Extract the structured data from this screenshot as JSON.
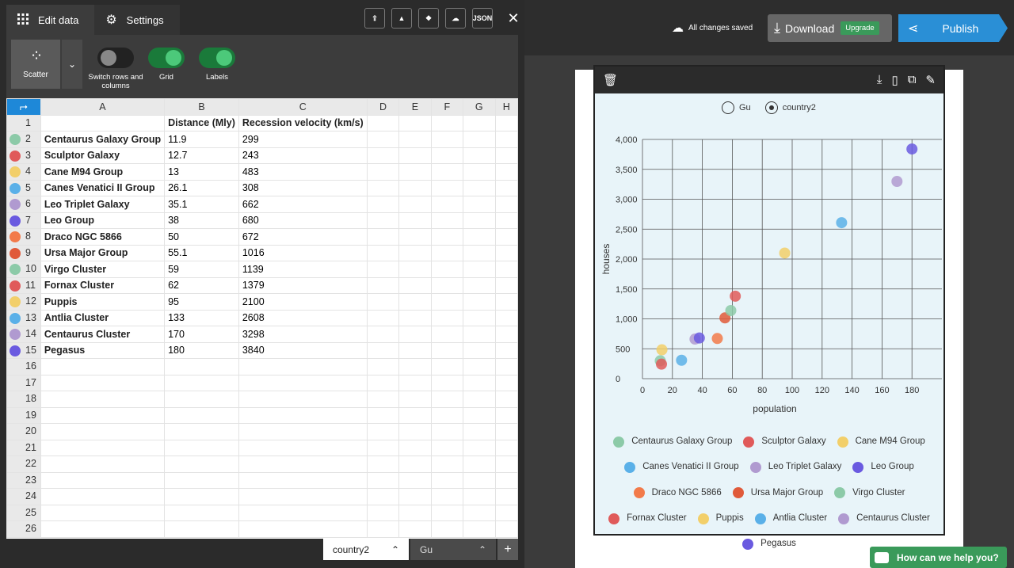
{
  "tabs": {
    "edit": "Edit data",
    "settings": "Settings"
  },
  "top_icons": {
    "json_label": "JSON",
    "close": "✕"
  },
  "toolbar": {
    "chart_type": "Scatter",
    "switch_label": "Switch rows and columns",
    "grid_label": "Grid",
    "labels_label": "Labels",
    "switch_on": false,
    "grid_on": true,
    "labels_on": true
  },
  "sheet": {
    "columns": [
      "A",
      "B",
      "C",
      "D",
      "E",
      "F",
      "G",
      "H"
    ],
    "header_row": [
      "",
      "Distance (Mly)",
      "Recession velocity (km/s)"
    ],
    "rows": [
      {
        "n": "2",
        "name": "Centaurus Galaxy Group",
        "b": "11.9",
        "c": "299",
        "color": "#8ccaa8"
      },
      {
        "n": "3",
        "name": "Sculptor Galaxy",
        "b": "12.7",
        "c": "243",
        "color": "#e05a5a"
      },
      {
        "n": "4",
        "name": "Cane M94 Group",
        "b": "13",
        "c": "483",
        "color": "#f2cf6a"
      },
      {
        "n": "5",
        "name": "Canes Venatici II Group",
        "b": "26.1",
        "c": "308",
        "color": "#5ab0e8"
      },
      {
        "n": "6",
        "name": "Leo Triplet Galaxy",
        "b": "35.1",
        "c": "662",
        "color": "#b09ad0"
      },
      {
        "n": "7",
        "name": "Leo Group",
        "b": "38",
        "c": "680",
        "color": "#6a5ae0"
      },
      {
        "n": "8",
        "name": "Draco NGC 5866",
        "b": "50",
        "c": "672",
        "color": "#f27a4a"
      },
      {
        "n": "9",
        "name": "Ursa Major Group",
        "b": "55.1",
        "c": "1016",
        "color": "#e05a3a"
      },
      {
        "n": "10",
        "name": "Virgo Cluster",
        "b": "59",
        "c": "1139",
        "color": "#8ccaa8"
      },
      {
        "n": "11",
        "name": "Fornax Cluster",
        "b": "62",
        "c": "1379",
        "color": "#e05a5a"
      },
      {
        "n": "12",
        "name": "Puppis",
        "b": "95",
        "c": "2100",
        "color": "#f2cf6a"
      },
      {
        "n": "13",
        "name": "Antlia Cluster",
        "b": "133",
        "c": "2608",
        "color": "#5ab0e8"
      },
      {
        "n": "14",
        "name": "Centaurus Cluster",
        "b": "170",
        "c": "3298",
        "color": "#b09ad0"
      },
      {
        "n": "15",
        "name": "Pegasus",
        "b": "180",
        "c": "3840",
        "color": "#6a5ae0"
      }
    ],
    "empty_rows": [
      "16",
      "17",
      "18",
      "19",
      "20",
      "21",
      "22",
      "23",
      "24",
      "25",
      "26"
    ],
    "first_row_number": "1"
  },
  "sheet_tabs": {
    "active": "country2",
    "inactive": "Gu",
    "add": "+"
  },
  "header": {
    "saved": "All changes saved",
    "download": "Download",
    "upgrade": "Upgrade",
    "publish": "Publish"
  },
  "chart_radio": {
    "opt1": "Gu",
    "opt2": "country2"
  },
  "help": "How can we help you?",
  "chart_data": {
    "type": "scatter",
    "xlabel": "population",
    "ylabel": "houses",
    "xlim": [
      0,
      200
    ],
    "ylim": [
      0,
      4000
    ],
    "x_ticks": [
      0,
      20,
      40,
      60,
      80,
      100,
      120,
      140,
      160,
      180
    ],
    "y_ticks": [
      0,
      500,
      1000,
      1500,
      2000,
      2500,
      3000,
      3500,
      4000
    ],
    "y_tick_labels": [
      "0",
      "500",
      "1,000",
      "1,500",
      "2,000",
      "2,500",
      "3,000",
      "3,500",
      "4,000"
    ],
    "grid": true,
    "legend_position": "bottom",
    "series": [
      {
        "name": "Centaurus Galaxy Group",
        "x": 11.9,
        "y": 299,
        "color": "#8ccaa8"
      },
      {
        "name": "Sculptor Galaxy",
        "x": 12.7,
        "y": 243,
        "color": "#e05a5a"
      },
      {
        "name": "Cane M94 Group",
        "x": 13,
        "y": 483,
        "color": "#f2cf6a"
      },
      {
        "name": "Canes Venatici II Group",
        "x": 26.1,
        "y": 308,
        "color": "#5ab0e8"
      },
      {
        "name": "Leo Triplet Galaxy",
        "x": 35.1,
        "y": 662,
        "color": "#b09ad0"
      },
      {
        "name": "Leo Group",
        "x": 38,
        "y": 680,
        "color": "#6a5ae0"
      },
      {
        "name": "Draco NGC 5866",
        "x": 50,
        "y": 672,
        "color": "#f27a4a"
      },
      {
        "name": "Ursa Major Group",
        "x": 55.1,
        "y": 1016,
        "color": "#e05a3a"
      },
      {
        "name": "Virgo Cluster",
        "x": 59,
        "y": 1139,
        "color": "#8ccaa8"
      },
      {
        "name": "Fornax Cluster",
        "x": 62,
        "y": 1379,
        "color": "#e05a5a"
      },
      {
        "name": "Puppis",
        "x": 95,
        "y": 2100,
        "color": "#f2cf6a"
      },
      {
        "name": "Antlia Cluster",
        "x": 133,
        "y": 2608,
        "color": "#5ab0e8"
      },
      {
        "name": "Centaurus Cluster",
        "x": 170,
        "y": 3298,
        "color": "#b09ad0"
      },
      {
        "name": "Pegasus",
        "x": 180,
        "y": 3840,
        "color": "#6a5ae0"
      }
    ]
  }
}
